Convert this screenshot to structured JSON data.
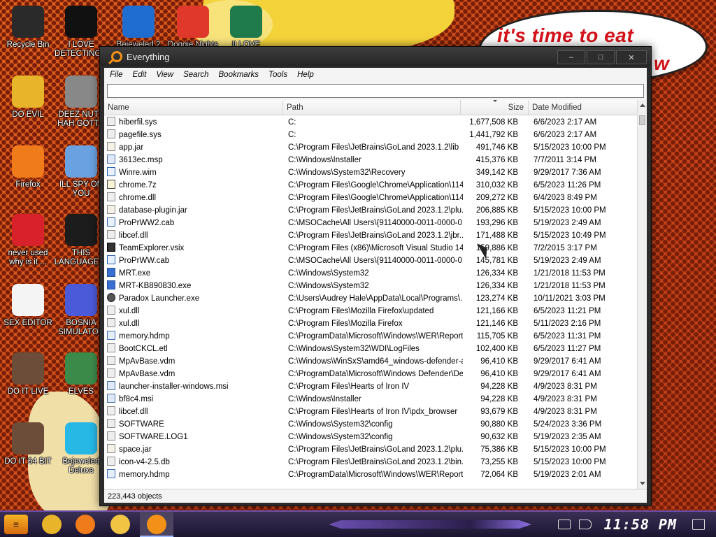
{
  "desktop": {
    "icons": [
      {
        "label": "Recycle Bin",
        "icon": "recycle-bin-icon",
        "color": "#2a2a2a"
      },
      {
        "label": "I LOVE\nDETECTING...",
        "icon": "detective-game-icon",
        "color": "#111111"
      },
      {
        "label": "Bejeweled 2",
        "icon": "bejeweled-icon",
        "color": "#1f6dd1"
      },
      {
        "label": "Doggie Nights",
        "icon": "game-icon",
        "color": "#e0382a"
      },
      {
        "label": "II LOVE",
        "icon": "project-icon",
        "color": "#1f7a4c"
      },
      {
        "label": "DO EVIL",
        "icon": "chrome-icon",
        "color": "#e8b52a"
      },
      {
        "label": "DEEZ NUTS\nHAH GOTT...",
        "icon": "copy-files-icon",
        "color": "#888888"
      },
      {
        "label": "Firefox",
        "icon": "firefox-icon",
        "color": "#f07b1a"
      },
      {
        "label": "ILL SPY ON\nYOU",
        "icon": "network-icon",
        "color": "#6aa1e0"
      },
      {
        "label": "never used\nwhy is it ...",
        "icon": "dev-cpp-icon",
        "color": "#d8212a"
      },
      {
        "label": "THIS\nLANGUAGE ...",
        "icon": "goland-icon",
        "color": "#1c1c1c"
      },
      {
        "label": "SEX EDITOR",
        "icon": "hxd-hex-editor-icon",
        "color": "#f4f4f4"
      },
      {
        "label": "BOSNIA\nSIMULATOR",
        "icon": "mine-icon",
        "color": "#4a5ad8"
      },
      {
        "label": "DO IT LIVE",
        "icon": "portrait-icon",
        "color": "#6b4d3a"
      },
      {
        "label": "ELVES",
        "icon": "elves-game-icon",
        "color": "#3c8a4a"
      },
      {
        "label": "DO IT 64 BIT",
        "icon": "portrait-64-icon",
        "color": "#6b4d3a"
      },
      {
        "label": "Bejeweled\nDeluxe",
        "icon": "diamond-icon",
        "color": "#27b8e6"
      }
    ]
  },
  "speech_bubble": {
    "line1": "it's time to eat",
    "line2": "w"
  },
  "window": {
    "title": "Everything",
    "minimize": "–",
    "maximize": "□",
    "close": "✕",
    "menu": [
      "File",
      "Edit",
      "View",
      "Search",
      "Bookmarks",
      "Tools",
      "Help"
    ],
    "search_value": "",
    "columns": {
      "name": "Name",
      "path": "Path",
      "size": "Size",
      "date": "Date Modified"
    },
    "rows": [
      {
        "name": "hiberfil.sys",
        "path": "C:",
        "size": "1,677,508 KB",
        "date": "6/6/2023 2:17 AM",
        "icon": "sys"
      },
      {
        "name": "pagefile.sys",
        "path": "C:",
        "size": "1,441,792 KB",
        "date": "6/6/2023 2:17 AM",
        "icon": "sys"
      },
      {
        "name": "app.jar",
        "path": "C:\\Program Files\\JetBrains\\GoLand 2023.1.2\\lib",
        "size": "491,746 KB",
        "date": "5/15/2023 10:00 PM",
        "icon": "jar"
      },
      {
        "name": "3613ec.msp",
        "path": "C:\\Windows\\Installer",
        "size": "415,376 KB",
        "date": "7/7/2011 3:14 PM",
        "icon": "msi"
      },
      {
        "name": "Winre.wim",
        "path": "C:\\Windows\\System32\\Recovery",
        "size": "349,142 KB",
        "date": "9/29/2017 7:36 AM",
        "icon": "cab"
      },
      {
        "name": "chrome.7z",
        "path": "C:\\Program Files\\Google\\Chrome\\Application\\114...",
        "size": "310,032 KB",
        "date": "6/5/2023 11:26 PM",
        "icon": "zip"
      },
      {
        "name": "chrome.dll",
        "path": "C:\\Program Files\\Google\\Chrome\\Application\\114...",
        "size": "209,272 KB",
        "date": "6/4/2023 8:49 PM",
        "icon": "sys"
      },
      {
        "name": "database-plugin.jar",
        "path": "C:\\Program Files\\JetBrains\\GoLand 2023.1.2\\plu...",
        "size": "206,885 KB",
        "date": "5/15/2023 10:00 PM",
        "icon": "jar"
      },
      {
        "name": "ProPrWW2.cab",
        "path": "C:\\MSOCache\\All Users\\{91140000-0011-0000-0...",
        "size": "193,296 KB",
        "date": "5/19/2023 2:49 AM",
        "icon": "cab"
      },
      {
        "name": "libcef.dll",
        "path": "C:\\Program Files\\JetBrains\\GoLand 2023.1.2\\jbr...",
        "size": "171,488 KB",
        "date": "5/15/2023 10:49 PM",
        "icon": "sys"
      },
      {
        "name": "TeamExplorer.vsix",
        "path": "C:\\Program Files (x86)\\Microsoft Visual Studio 14....",
        "size": "159,886 KB",
        "date": "7/2/2015 3:17 PM",
        "icon": "vsix"
      },
      {
        "name": "ProPrWW.cab",
        "path": "C:\\MSOCache\\All Users\\{91140000-0011-0000-0...",
        "size": "145,781 KB",
        "date": "5/19/2023 2:49 AM",
        "icon": "cab"
      },
      {
        "name": "MRT.exe",
        "path": "C:\\Windows\\System32",
        "size": "126,334 KB",
        "date": "1/21/2018 11:53 PM",
        "icon": "exe"
      },
      {
        "name": "MRT-KB890830.exe",
        "path": "C:\\Windows\\System32",
        "size": "126,334 KB",
        "date": "1/21/2018 11:53 PM",
        "icon": "exe"
      },
      {
        "name": "Paradox Launcher.exe",
        "path": "C:\\Users\\Audrey Hale\\AppData\\Local\\Programs\\...",
        "size": "123,274 KB",
        "date": "10/11/2021 3:03 PM",
        "icon": "game"
      },
      {
        "name": "xul.dll",
        "path": "C:\\Program Files\\Mozilla Firefox\\updated",
        "size": "121,166 KB",
        "date": "6/5/2023 11:21 PM",
        "icon": "sys"
      },
      {
        "name": "xul.dll",
        "path": "C:\\Program Files\\Mozilla Firefox",
        "size": "121,146 KB",
        "date": "5/11/2023 2:16 PM",
        "icon": "sys"
      },
      {
        "name": "memory.hdmp",
        "path": "C:\\ProgramData\\Microsoft\\Windows\\WER\\Report...",
        "size": "115,705 KB",
        "date": "6/5/2023 11:31 PM",
        "icon": "dmp"
      },
      {
        "name": "BootCKCL.etl",
        "path": "C:\\Windows\\System32\\WDI\\LogFiles",
        "size": "102,400 KB",
        "date": "6/5/2023 11:27 PM",
        "icon": "sys"
      },
      {
        "name": "MpAvBase.vdm",
        "path": "C:\\Windows\\WinSxS\\amd64_windows-defender-a...",
        "size": "96,410 KB",
        "date": "9/29/2017 6:41 AM",
        "icon": "sys"
      },
      {
        "name": "MpAvBase.vdm",
        "path": "C:\\ProgramData\\Microsoft\\Windows Defender\\De...",
        "size": "96,410 KB",
        "date": "9/29/2017 6:41 AM",
        "icon": "sys"
      },
      {
        "name": "launcher-installer-windows.msi",
        "path": "C:\\Program Files\\Hearts of Iron IV",
        "size": "94,228 KB",
        "date": "4/9/2023 8:31 PM",
        "icon": "msi"
      },
      {
        "name": "bf8c4.msi",
        "path": "C:\\Windows\\Installer",
        "size": "94,228 KB",
        "date": "4/9/2023 8:31 PM",
        "icon": "msi"
      },
      {
        "name": "libcef.dll",
        "path": "C:\\Program Files\\Hearts of Iron IV\\pdx_browser",
        "size": "93,679 KB",
        "date": "4/9/2023 8:31 PM",
        "icon": "sys"
      },
      {
        "name": "SOFTWARE",
        "path": "C:\\Windows\\System32\\config",
        "size": "90,880 KB",
        "date": "5/24/2023 3:36 PM",
        "icon": "sys"
      },
      {
        "name": "SOFTWARE.LOG1",
        "path": "C:\\Windows\\System32\\config",
        "size": "90,632 KB",
        "date": "5/19/2023 2:35 AM",
        "icon": "sys"
      },
      {
        "name": "space.jar",
        "path": "C:\\Program Files\\JetBrains\\GoLand 2023.1.2\\plu...",
        "size": "75,386 KB",
        "date": "5/15/2023 10:00 PM",
        "icon": "jar"
      },
      {
        "name": "icon-v4-2.5.db",
        "path": "C:\\Program Files\\JetBrains\\GoLand 2023.1.2\\bin...",
        "size": "73,255 KB",
        "date": "5/15/2023 10:00 PM",
        "icon": "sys"
      },
      {
        "name": "memory.hdmp",
        "path": "C:\\ProgramData\\Microsoft\\Windows\\WER\\Report...",
        "size": "72,064 KB",
        "date": "5/19/2023 2:01 AM",
        "icon": "dmp"
      }
    ],
    "status": "223,443 objects"
  },
  "taskbar": {
    "start_label": "≡",
    "apps": [
      {
        "icon": "chrome-icon",
        "color": "#e8b52a"
      },
      {
        "icon": "firefox-icon",
        "color": "#f07b1a"
      },
      {
        "icon": "file-explorer-icon",
        "color": "#f2c443"
      },
      {
        "icon": "everything-icon",
        "color": "#f29018"
      }
    ],
    "clock": "11:58 PM"
  }
}
